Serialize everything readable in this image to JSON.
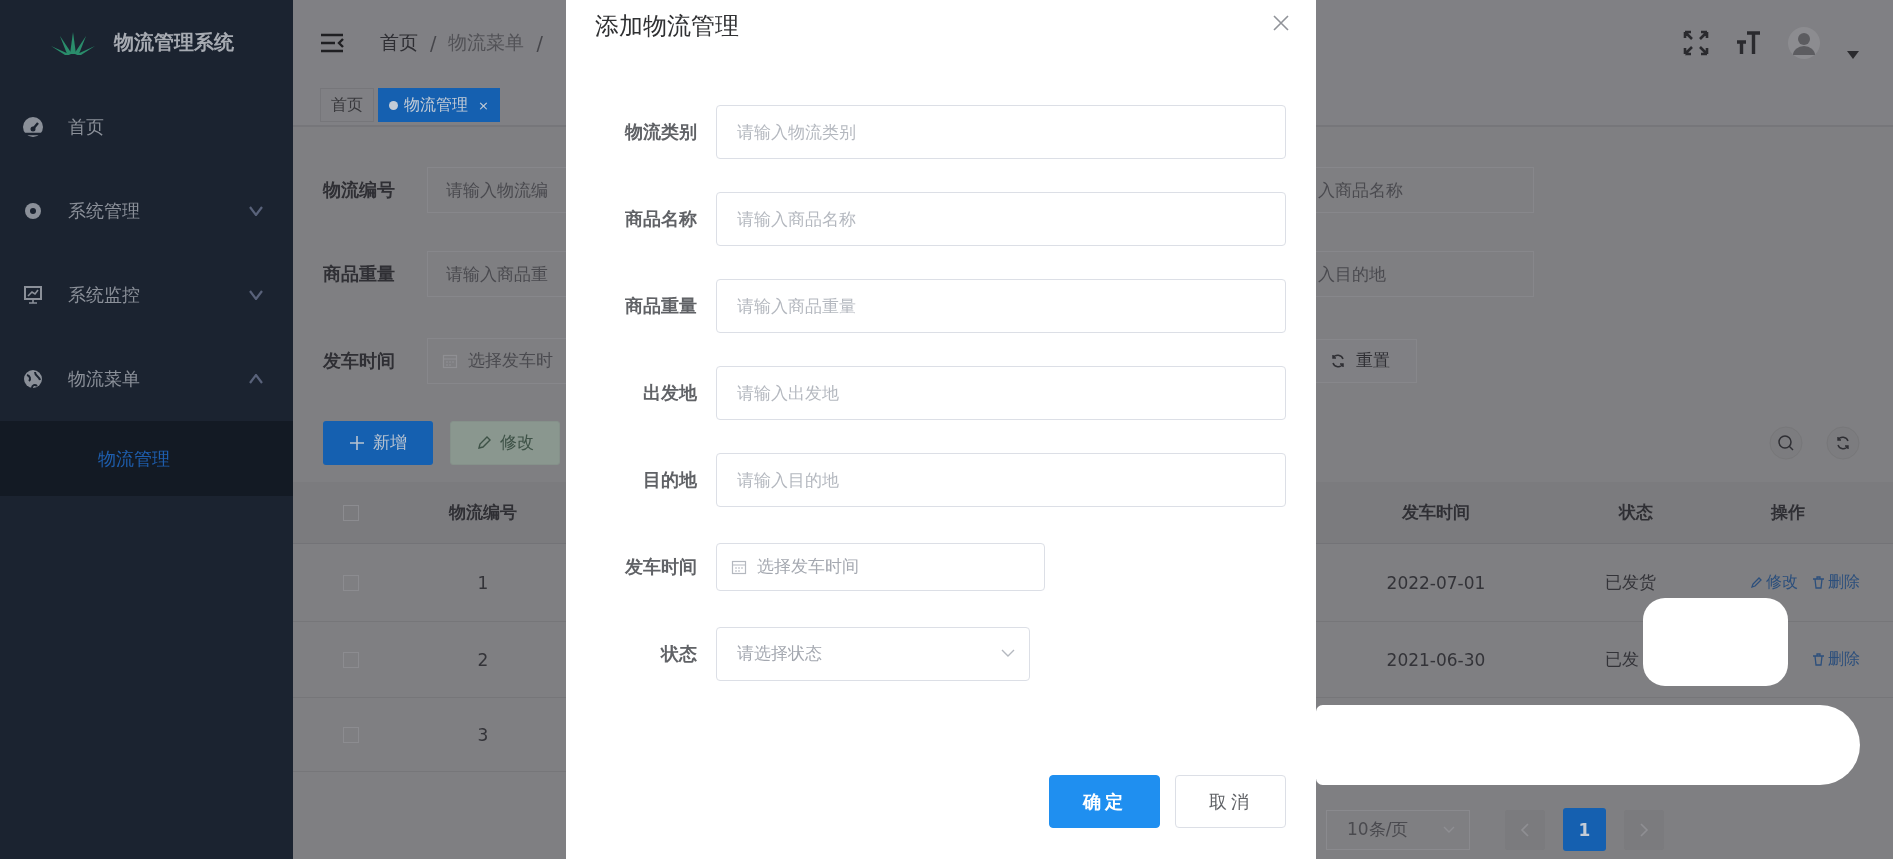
{
  "sidebar": {
    "title": "物流管理系统",
    "items": [
      {
        "label": "首页",
        "kind": "link"
      },
      {
        "label": "系统管理",
        "kind": "submenu",
        "expanded": false
      },
      {
        "label": "系统监控",
        "kind": "submenu",
        "expanded": false
      },
      {
        "label": "物流菜单",
        "kind": "submenu",
        "expanded": true,
        "children": [
          {
            "label": "物流管理",
            "selected": true
          }
        ]
      }
    ]
  },
  "header": {
    "breadcrumb": [
      "首页",
      "/",
      "物流菜单",
      "/"
    ]
  },
  "tags": [
    {
      "label": "首页",
      "selected": false
    },
    {
      "label": "物流管理",
      "selected": true,
      "close": "×"
    }
  ],
  "search_form": {
    "left": [
      {
        "label": "物流编号",
        "placeholder": "请输入物流编",
        "kind": "text"
      },
      {
        "label": "商品重量",
        "placeholder": "请输入商品重",
        "kind": "text"
      },
      {
        "label": "发车时间",
        "placeholder": "选择发车时",
        "kind": "date"
      }
    ],
    "right": [
      {
        "placeholder": "入商品名称",
        "kind": "text"
      },
      {
        "placeholder": "入目的地",
        "kind": "text"
      },
      {
        "label": "重置",
        "kind": "button"
      }
    ]
  },
  "toolbar": [
    {
      "label": "新增",
      "kind": "add",
      "disabled": false
    },
    {
      "label": "修改",
      "kind": "edit",
      "disabled": true
    }
  ],
  "table_left": {
    "header_checked": false,
    "columns": [
      "物流编号"
    ],
    "rows": [
      {
        "checked": false,
        "cells": [
          "1"
        ]
      },
      {
        "checked": false,
        "cells": [
          "2"
        ]
      },
      {
        "checked": false,
        "cells": [
          "3"
        ]
      }
    ]
  },
  "table_right": {
    "columns": [
      "发车时间",
      "状态",
      "操作"
    ],
    "rows": [
      {
        "cells": [
          "2022-07-01",
          "已发货"
        ],
        "actions": [
          {
            "label": "修改",
            "kind": "edit"
          },
          {
            "label": "删除",
            "kind": "delete"
          }
        ]
      },
      {
        "cells": [
          "2021-06-30",
          "已发"
        ],
        "actions": [
          {
            "label": "删除",
            "kind": "delete"
          }
        ]
      }
    ]
  },
  "pagination": {
    "page_size": "10条/页",
    "pages": [
      {
        "label": "1",
        "selected": true
      }
    ]
  },
  "modal": {
    "title": "添加物流管理",
    "fields": [
      {
        "label": "物流类别",
        "placeholder": "请输入物流类别",
        "kind": "text"
      },
      {
        "label": "商品名称",
        "placeholder": "请输入商品名称",
        "kind": "text"
      },
      {
        "label": "商品重量",
        "placeholder": "请输入商品重量",
        "kind": "text"
      },
      {
        "label": "出发地",
        "placeholder": "请输入出发地",
        "kind": "text"
      },
      {
        "label": "目的地",
        "placeholder": "请输入目的地",
        "kind": "text"
      },
      {
        "label": "发车时间",
        "placeholder": "选择发车时间",
        "kind": "date"
      },
      {
        "label": "状态",
        "placeholder": "请选择状态",
        "kind": "select"
      }
    ],
    "buttons": [
      {
        "label": "确定",
        "kind": "primary"
      },
      {
        "label": "取消",
        "kind": "default"
      }
    ]
  }
}
